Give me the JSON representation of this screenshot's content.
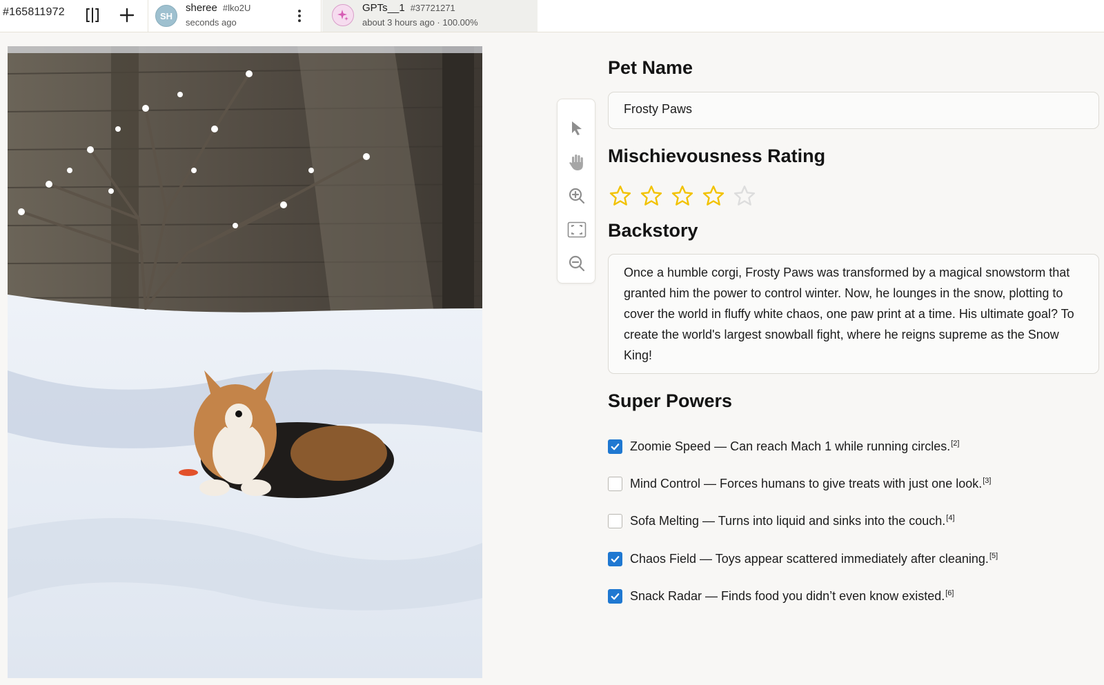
{
  "topbar": {
    "task_id": "#165811972",
    "icons": [
      "split-view-icon",
      "plus-icon"
    ],
    "tabs": [
      {
        "avatar_text": "SH",
        "name": "sheree",
        "tag": "#lko2U",
        "subtitle": "seconds ago",
        "menu_icon": "kebab-menu-icon"
      },
      {
        "avatar_icon": "sparkle-icon",
        "name": "GPTs__1",
        "tag": "#37721271",
        "subtitle": "about 3 hours ago · 100.00%"
      }
    ]
  },
  "photo": {
    "description_icon": "corgi-in-snow-photo"
  },
  "tools": [
    "pointer-tool-icon",
    "hand-tool-icon",
    "zoom-in-icon",
    "fit-screen-icon",
    "zoom-out-icon"
  ],
  "form": {
    "pet_name_label": "Pet Name",
    "pet_name_value": "Frosty Paws",
    "rating_label": "Mischievousness Rating",
    "rating": 4,
    "rating_max": 5,
    "backstory_label": "Backstory",
    "backstory_value": "Once a humble corgi, Frosty Paws was transformed by a magical snowstorm that granted him the power to control winter. Now, he lounges in the snow, plotting to cover the world in fluffy white chaos, one paw print at a time. His ultimate goal? To create the world's largest snowball fight, where he reigns supreme as the Snow King!",
    "powers_label": "Super Powers",
    "powers": [
      {
        "text": "Zoomie Speed — Can reach Mach 1 while running circles.",
        "ref": "[2]",
        "checked": true
      },
      {
        "text": "Mind Control — Forces humans to give treats with just one look.",
        "ref": "[3]",
        "checked": false
      },
      {
        "text": "Sofa Melting — Turns into liquid and sinks into the couch.",
        "ref": "[4]",
        "checked": false
      },
      {
        "text": "Chaos Field — Toys appear scattered immediately after cleaning.",
        "ref": "[5]",
        "checked": true
      },
      {
        "text": "Snack Radar — Finds food you didn’t even know existed.",
        "ref": "[6]",
        "checked": true
      }
    ]
  },
  "colors": {
    "accent": "#1f78d1",
    "star_filled": "#f2c200",
    "star_empty": "#dddddd"
  }
}
